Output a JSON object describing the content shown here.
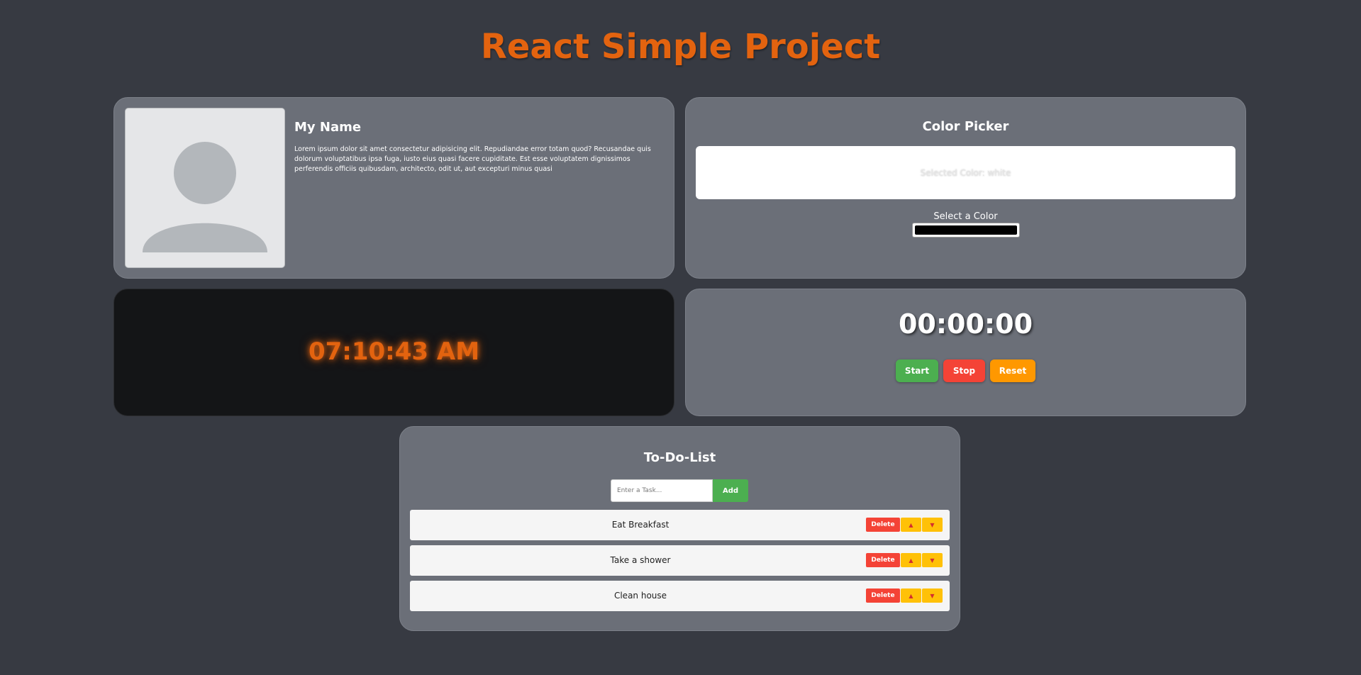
{
  "header": {
    "title": "React Simple Project"
  },
  "profile": {
    "name": "My Name",
    "bio": "Lorem ipsum dolor sit amet consectetur adipisicing elit. Repudiandae error totam quod? Recusandae quis dolorum voluptatibus ipsa fuga, iusto eius quasi facere cupiditate. Est esse voluptatem dignissimos perferendis officiis quibusdam, architecto, odit ut, aut excepturi minus quasi",
    "avatar_icon": "user-silhouette-icon"
  },
  "color_picker": {
    "title": "Color Picker",
    "display_text": "Selected Color: white",
    "selected_color": "#ffffff",
    "label": "Select a Color",
    "input_value": "#000000"
  },
  "clock": {
    "time": "07:10:43 AM",
    "color": "#e3630f"
  },
  "stopwatch": {
    "time": "00:00:00",
    "start_label": "Start",
    "stop_label": "Stop",
    "reset_label": "Reset"
  },
  "todo": {
    "title": "To-Do-List",
    "input_placeholder": "Enter a Task...",
    "input_value": "",
    "add_label": "Add",
    "delete_label": "Delete",
    "up_label": "▲",
    "down_label": "▼",
    "items": [
      {
        "text": "Eat Breakfast"
      },
      {
        "text": "Take a shower"
      },
      {
        "text": "Clean house"
      }
    ]
  },
  "colors": {
    "background": "#373a42",
    "card": "#6b6f78",
    "accent": "#e3630f",
    "green": "#4caf50",
    "red": "#f44336",
    "orange": "#ff9800",
    "yellow": "#ffc107"
  }
}
